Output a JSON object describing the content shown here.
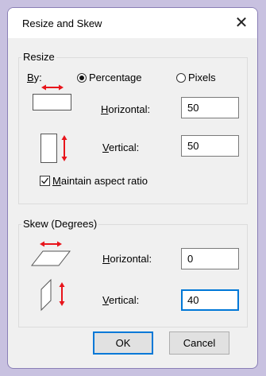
{
  "dialog": {
    "title": "Resize and Skew",
    "close_glyph": "✕"
  },
  "resize": {
    "group_label": "Resize",
    "by_label": "By:",
    "percentage_label": "Percentage",
    "pixels_label": "Pixels",
    "selected_unit": "Percentage",
    "horizontal_label": "Horizontal:",
    "horizontal_value": "50",
    "vertical_label": "Vertical:",
    "vertical_value": "50",
    "maintain_label": "Maintain aspect ratio",
    "maintain_checked": true
  },
  "skew": {
    "group_label": "Skew (Degrees)",
    "horizontal_label": "Horizontal:",
    "horizontal_value": "0",
    "vertical_label": "Vertical:",
    "vertical_value": "40"
  },
  "buttons": {
    "ok_label": "OK",
    "cancel_label": "Cancel"
  },
  "icons": {
    "resize_horizontal": "resize-horizontal-icon",
    "resize_vertical": "resize-vertical-icon",
    "skew_horizontal": "skew-horizontal-icon",
    "skew_vertical": "skew-vertical-icon",
    "arrow_color": "#e8141b"
  },
  "colors": {
    "backdrop": "#c8c1e0",
    "dialog_border": "#8a7fb6",
    "focus_accent": "#0078d7"
  }
}
